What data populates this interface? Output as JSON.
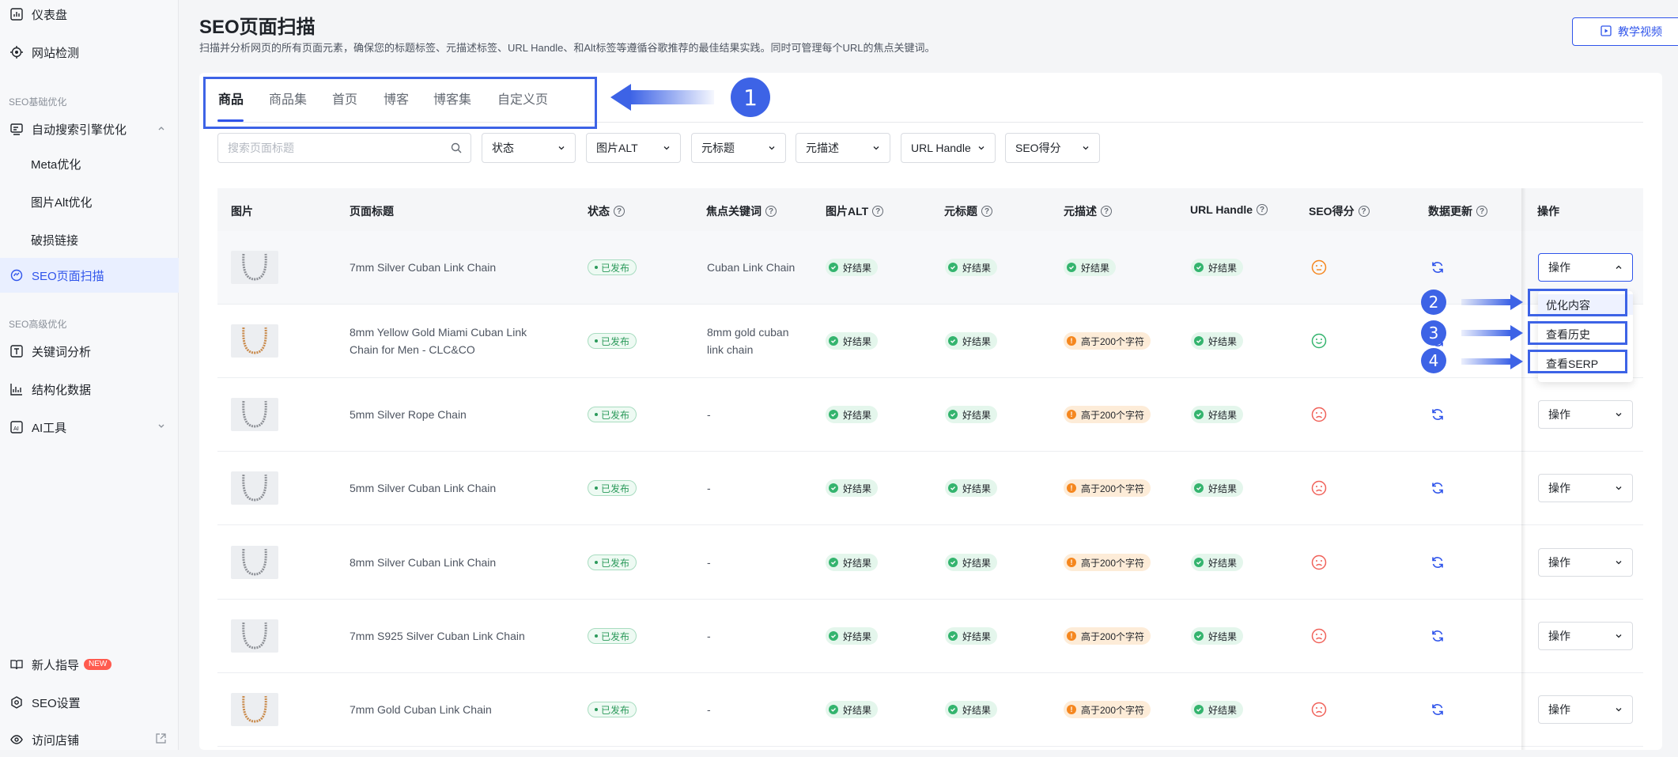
{
  "sidebar": {
    "items": [
      {
        "label": "仪表盘"
      },
      {
        "label": "网站检测"
      },
      {
        "label": "自动搜索引擎优化"
      },
      {
        "label": "Meta优化"
      },
      {
        "label": "图片Alt优化"
      },
      {
        "label": "破损链接"
      },
      {
        "label": "SEO页面扫描"
      },
      {
        "label": "关键词分析"
      },
      {
        "label": "结构化数据"
      },
      {
        "label": "AI工具"
      },
      {
        "label": "新人指导"
      },
      {
        "label": "SEO设置"
      },
      {
        "label": "访问店铺"
      }
    ],
    "groups": [
      "SEO基础优化",
      "SEO高级优化"
    ],
    "new_badge": "NEW"
  },
  "header": {
    "title": "SEO页面扫描",
    "description": "扫描并分析网页的所有页面元素，确保您的标题标签、元描述标签、URL Handle、和Alt标签等遵循谷歌推荐的最佳结果实践。同时可管理每个URL的焦点关键词。",
    "tutorial_label": "教学视频"
  },
  "tabs": [
    "商品",
    "商品集",
    "首页",
    "博客",
    "博客集",
    "自定义页"
  ],
  "active_tab": "商品",
  "filters": {
    "search_placeholder": "搜索页面标题",
    "selects": [
      "状态",
      "图片ALT",
      "元标题",
      "元描述",
      "URL Handle",
      "SEO得分"
    ]
  },
  "table": {
    "columns": [
      "图片",
      "页面标题",
      "状态",
      "焦点关键词",
      "图片ALT",
      "元标题",
      "元描述",
      "URL Handle",
      "SEO得分",
      "数据更新",
      "操作"
    ],
    "rows": [
      {
        "title": "7mm Silver Cuban Link Chain",
        "status": "已发布",
        "keyword": "Cuban Link Chain",
        "alt": "好结果",
        "meta_title": "好结果",
        "meta_desc": "好结果",
        "url_handle": "好结果",
        "score": "neutral",
        "chain": "silver"
      },
      {
        "title": "8mm Yellow Gold Miami Cuban Link Chain for Men - CLC&CO",
        "status": "已发布",
        "keyword": "8mm gold cuban link chain",
        "alt": "好结果",
        "meta_title": "好结果",
        "meta_desc": "高于200个字符",
        "url_handle": "好结果",
        "score": "good",
        "chain": "gold"
      },
      {
        "title": "5mm Silver Rope Chain",
        "status": "已发布",
        "keyword": "-",
        "alt": "好结果",
        "meta_title": "好结果",
        "meta_desc": "高于200个字符",
        "url_handle": "好结果",
        "score": "bad",
        "chain": "silver"
      },
      {
        "title": "5mm Silver Cuban Link Chain",
        "status": "已发布",
        "keyword": "-",
        "alt": "好结果",
        "meta_title": "好结果",
        "meta_desc": "高于200个字符",
        "url_handle": "好结果",
        "score": "bad",
        "chain": "silver"
      },
      {
        "title": "8mm Silver Cuban Link Chain",
        "status": "已发布",
        "keyword": "-",
        "alt": "好结果",
        "meta_title": "好结果",
        "meta_desc": "高于200个字符",
        "url_handle": "好结果",
        "score": "bad",
        "chain": "silver"
      },
      {
        "title": "7mm S925 Silver Cuban Link Chain",
        "status": "已发布",
        "keyword": "-",
        "alt": "好结果",
        "meta_title": "好结果",
        "meta_desc": "高于200个字符",
        "url_handle": "好结果",
        "score": "bad",
        "chain": "silver"
      },
      {
        "title": "7mm Gold Cuban Link Chain",
        "status": "已发布",
        "keyword": "-",
        "alt": "好结果",
        "meta_title": "好结果",
        "meta_desc": "高于200个字符",
        "url_handle": "好结果",
        "score": "bad",
        "chain": "gold"
      }
    ],
    "action_label": "操作"
  },
  "action_menu": [
    "优化内容",
    "查看历史",
    "查看SERP"
  ],
  "annotations": [
    "1",
    "2",
    "3",
    "4"
  ],
  "colors": {
    "accent": "#2f54eb",
    "annotation": "#3d63e6",
    "good": "#34b46e",
    "warn": "#f5871f",
    "bad": "#f0625a"
  }
}
